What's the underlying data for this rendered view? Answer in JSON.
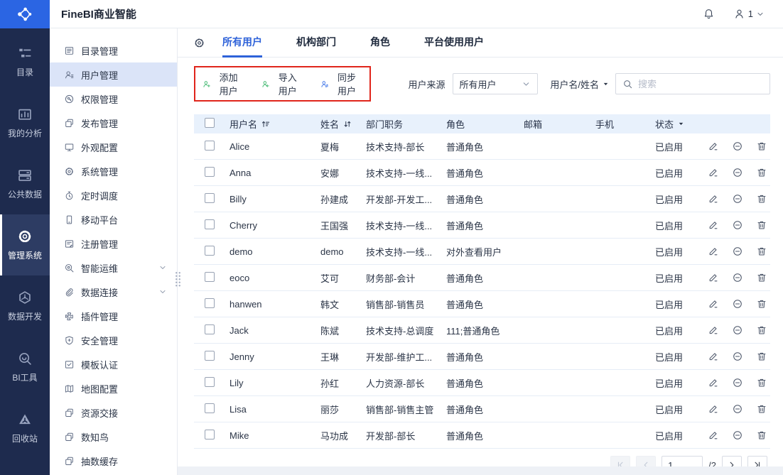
{
  "header": {
    "title": "FineBI商业智能",
    "user_count": "1"
  },
  "colors": {
    "accent": "#2e62d9",
    "rail_bg": "#1e2b4e",
    "logo_bg": "#2b65e3",
    "highlight_border": "#e0251b",
    "add_icon": "#3cb66c",
    "import_icon": "#3cb66c",
    "sync_icon": "#3e74e8",
    "table_header_bg": "#e8f1fc",
    "active_menu_bg": "#dbe4f8"
  },
  "rail": {
    "items": [
      {
        "id": "catalog",
        "label": "目录",
        "glyph": "rail-catalog",
        "active": false
      },
      {
        "id": "my-analysis",
        "label": "我的分析",
        "glyph": "rail-analysis",
        "active": false
      },
      {
        "id": "public-data",
        "label": "公共数据",
        "glyph": "rail-data",
        "active": false
      },
      {
        "id": "admin-system",
        "label": "管理系统",
        "glyph": "rail-admin",
        "active": true
      },
      {
        "id": "data-dev",
        "label": "数据开发",
        "glyph": "rail-dev",
        "active": false
      },
      {
        "id": "bi-tools",
        "label": "BI工具",
        "glyph": "rail-tools",
        "active": false
      },
      {
        "id": "recycle-bin",
        "label": "回收站",
        "glyph": "rail-recycle",
        "active": false
      }
    ]
  },
  "sidebar": {
    "items": [
      {
        "id": "catalog-mgmt",
        "label": "目录管理",
        "glyph": "doc-list",
        "active": false
      },
      {
        "id": "user-mgmt",
        "label": "用户管理",
        "glyph": "user",
        "active": true
      },
      {
        "id": "perm-mgmt",
        "label": "权限管理",
        "glyph": "key-circle",
        "active": false
      },
      {
        "id": "publish-mgmt",
        "label": "发布管理",
        "glyph": "copy",
        "active": false
      },
      {
        "id": "appearance-config",
        "label": "外观配置",
        "glyph": "screen",
        "active": false
      },
      {
        "id": "system-mgmt",
        "label": "系统管理",
        "glyph": "gear",
        "active": false
      },
      {
        "id": "schedule",
        "label": "定时调度",
        "glyph": "stopwatch",
        "active": false
      },
      {
        "id": "mobile-platform",
        "label": "移动平台",
        "glyph": "phone",
        "active": false
      },
      {
        "id": "register-mgmt",
        "label": "注册管理",
        "glyph": "doc-edit",
        "active": false
      },
      {
        "id": "intelligent-ops",
        "label": "智能运维",
        "glyph": "magnify-gear",
        "active": false,
        "collapsible": true
      },
      {
        "id": "data-connection",
        "label": "数据连接",
        "glyph": "paperclip",
        "active": false,
        "collapsible": true
      },
      {
        "id": "plugin-mgmt",
        "label": "插件管理",
        "glyph": "puzzle",
        "active": false
      },
      {
        "id": "security-mgmt",
        "label": "安全管理",
        "glyph": "shield-plus",
        "active": false
      },
      {
        "id": "template-cert",
        "label": "模板认证",
        "glyph": "doc-check",
        "active": false
      },
      {
        "id": "map-config",
        "label": "地图配置",
        "glyph": "map",
        "active": false
      },
      {
        "id": "resource-handover",
        "label": "资源交接",
        "glyph": "copy",
        "active": false
      },
      {
        "id": "shuzhiniao",
        "label": "数知鸟",
        "glyph": "copy",
        "active": false
      },
      {
        "id": "extract-cache",
        "label": "抽数缓存",
        "glyph": "copy",
        "active": false
      }
    ]
  },
  "tabs": {
    "items": [
      {
        "id": "all-users",
        "label": "所有用户",
        "active": true
      },
      {
        "id": "org-dept",
        "label": "机构部门",
        "active": false
      },
      {
        "id": "roles",
        "label": "角色",
        "active": false
      },
      {
        "id": "platform-users",
        "label": "平台使用用户",
        "active": false
      }
    ]
  },
  "toolbar": {
    "actions": [
      {
        "id": "add-user",
        "label": "添加用户",
        "glyph": "user-add",
        "icon_color": "#3cb66c"
      },
      {
        "id": "import-user",
        "label": "导入用户",
        "glyph": "user-import",
        "icon_color": "#3cb66c"
      },
      {
        "id": "sync-user",
        "label": "同步用户",
        "glyph": "user-sync",
        "icon_color": "#3e74e8"
      }
    ],
    "filter_label": "用户来源",
    "filter_value": "所有用户",
    "search_field_label": "用户名/姓名",
    "search_placeholder": "搜索"
  },
  "table": {
    "columns": [
      {
        "key": "username",
        "label": "用户名",
        "sort": "asc"
      },
      {
        "key": "name",
        "label": "姓名",
        "sort": "both"
      },
      {
        "key": "dept",
        "label": "部门职务"
      },
      {
        "key": "role",
        "label": "角色"
      },
      {
        "key": "email",
        "label": "邮箱"
      },
      {
        "key": "phone",
        "label": "手机"
      },
      {
        "key": "status",
        "label": "状态",
        "filter": true
      }
    ],
    "row_actions": [
      {
        "id": "edit",
        "glyph": "pencil"
      },
      {
        "id": "disable",
        "glyph": "minus-circle"
      },
      {
        "id": "delete",
        "glyph": "trash"
      }
    ],
    "rows": [
      {
        "username": "Alice",
        "name": "夏梅",
        "dept": "技术支持-部长",
        "role": "普通角色",
        "email": "",
        "phone": "",
        "status": "已启用"
      },
      {
        "username": "Anna",
        "name": "安娜",
        "dept": "技术支持-一线...",
        "role": "普通角色",
        "email": "",
        "phone": "",
        "status": "已启用"
      },
      {
        "username": "Billy",
        "name": "孙建成",
        "dept": "开发部-开发工...",
        "role": "普通角色",
        "email": "",
        "phone": "",
        "status": "已启用"
      },
      {
        "username": "Cherry",
        "name": "王国强",
        "dept": "技术支持-一线...",
        "role": "普通角色",
        "email": "",
        "phone": "",
        "status": "已启用"
      },
      {
        "username": "demo",
        "name": "demo",
        "dept": "技术支持-一线...",
        "role": "对外查看用户",
        "email": "",
        "phone": "",
        "status": "已启用"
      },
      {
        "username": "eoco",
        "name": "艾可",
        "dept": "财务部-会计",
        "role": "普通角色",
        "email": "",
        "phone": "",
        "status": "已启用"
      },
      {
        "username": "hanwen",
        "name": "韩文",
        "dept": "销售部-销售员",
        "role": "普通角色",
        "email": "",
        "phone": "",
        "status": "已启用"
      },
      {
        "username": "Jack",
        "name": "陈斌",
        "dept": "技术支持-总调度",
        "role": "111;普通角色",
        "email": "",
        "phone": "",
        "status": "已启用"
      },
      {
        "username": "Jenny",
        "name": "王琳",
        "dept": "开发部-维护工...",
        "role": "普通角色",
        "email": "",
        "phone": "",
        "status": "已启用"
      },
      {
        "username": "Lily",
        "name": "孙红",
        "dept": "人力资源-部长",
        "role": "普通角色",
        "email": "",
        "phone": "",
        "status": "已启用"
      },
      {
        "username": "Lisa",
        "name": "丽莎",
        "dept": "销售部-销售主管",
        "role": "普通角色",
        "email": "",
        "phone": "",
        "status": "已启用"
      },
      {
        "username": "Mike",
        "name": "马功成",
        "dept": "开发部-部长",
        "role": "普通角色",
        "email": "",
        "phone": "",
        "status": "已启用"
      }
    ]
  },
  "pagination": {
    "current": "1",
    "total": "/2"
  }
}
